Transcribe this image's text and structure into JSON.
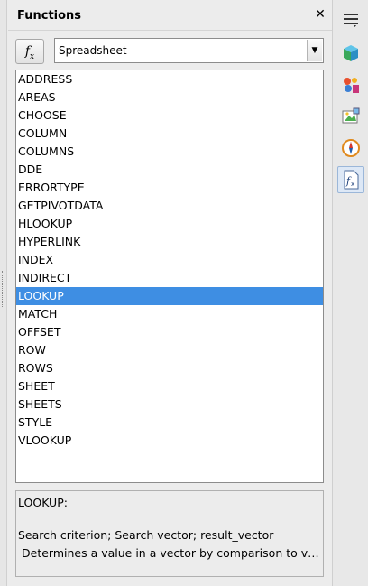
{
  "panel": {
    "title": "Functions",
    "close_glyph": "✕",
    "insert_button_label": "fx",
    "category": {
      "selected": "Spreadsheet"
    }
  },
  "functions": [
    "ADDRESS",
    "AREAS",
    "CHOOSE",
    "COLUMN",
    "COLUMNS",
    "DDE",
    "ERRORTYPE",
    "GETPIVOTDATA",
    "HLOOKUP",
    "HYPERLINK",
    "INDEX",
    "INDIRECT",
    "LOOKUP",
    "MATCH",
    "OFFSET",
    "ROW",
    "ROWS",
    "SHEET",
    "SHEETS",
    "STYLE",
    "VLOOKUP"
  ],
  "selected_function": "LOOKUP",
  "description": {
    "name": "LOOKUP:",
    "syntax": "Search criterion; Search vector; result_vector",
    "text": "Determines a value in a vector by comparison to valu..."
  },
  "tabbar": {
    "items": [
      {
        "icon": "menu-icon"
      },
      {
        "icon": "properties-icon"
      },
      {
        "icon": "styles-icon"
      },
      {
        "icon": "gallery-icon"
      },
      {
        "icon": "navigator-icon"
      },
      {
        "icon": "functions-icon",
        "active": true
      }
    ]
  },
  "colors": {
    "selection": "#3e8ee3",
    "panel_bg": "#ececec"
  }
}
